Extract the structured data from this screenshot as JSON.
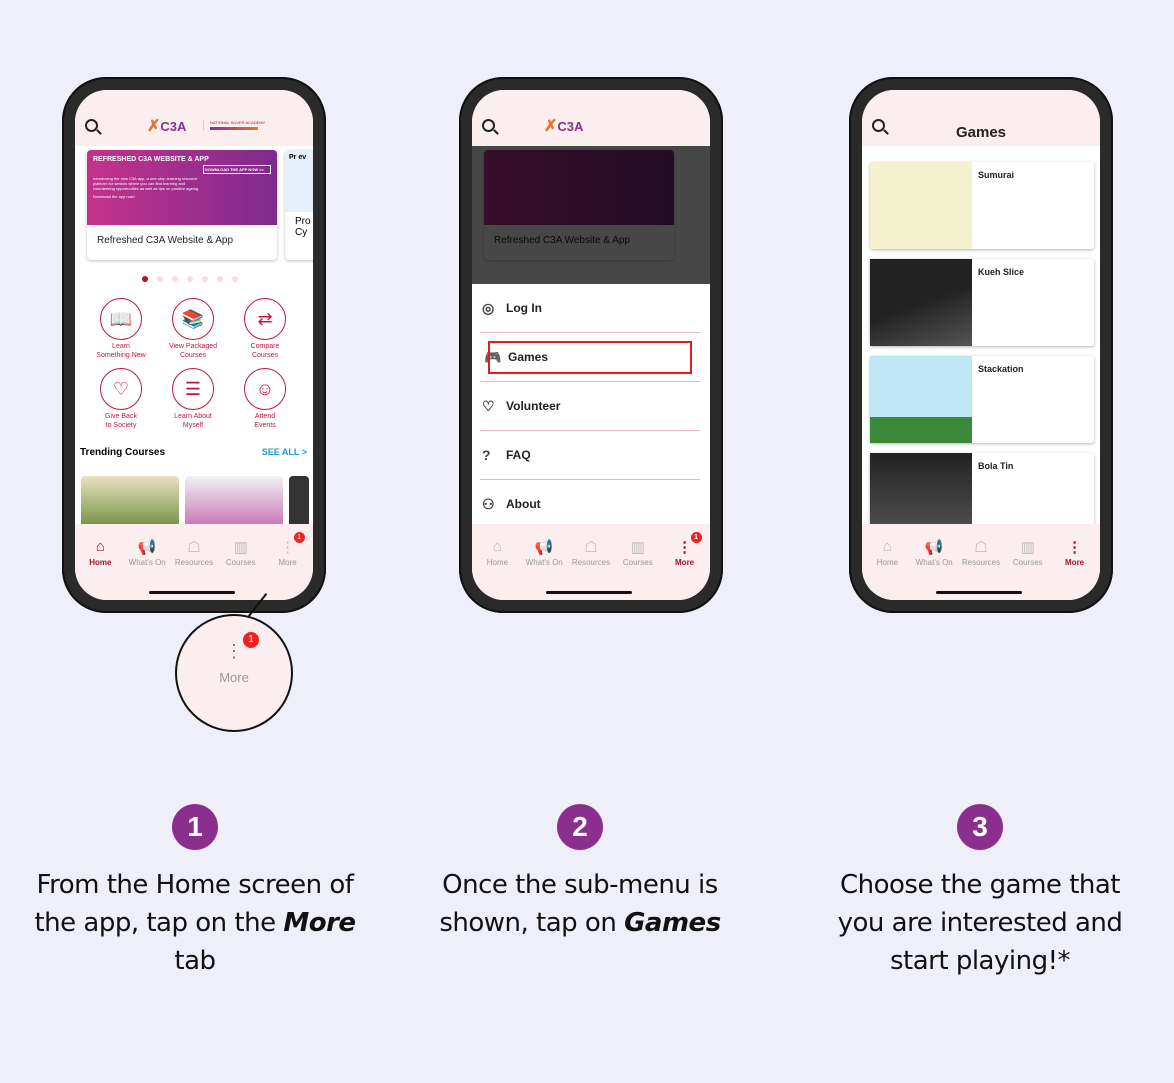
{
  "colors": {
    "accent": "#b0102c",
    "step": "#8b2f8f",
    "highlight": "#e01c1c",
    "link": "#1a9bd1"
  },
  "app": {
    "logo": "C3A",
    "partner_logo": "NATIONAL SILVER ACADEMY",
    "search_icon": "search-icon"
  },
  "home": {
    "banner": {
      "headline": "REFRESHED C3A WEBSITE & APP",
      "cta": "DOWNLOAD THE APP NOW >>",
      "body": "Introducing the new C3A app, a one-stop learning resource platform for seniors where you can find learning and volunteering opportunities as well as tips on positive ageing.",
      "download": "Download the app now!",
      "caption": "Refreshed C3A Website & App"
    },
    "banner2": {
      "title": "Pr ev",
      "caption": "Pro Cy"
    },
    "grid": [
      {
        "l1": "Learn",
        "l2": "Something New",
        "icon": "📖"
      },
      {
        "l1": "View Packaged",
        "l2": "Courses",
        "icon": "📚"
      },
      {
        "l1": "Compare",
        "l2": "Courses",
        "icon": "⇄"
      },
      {
        "l1": "Give Back",
        "l2": "to Society",
        "icon": "♡"
      },
      {
        "l1": "Learn About",
        "l2": "Myself",
        "icon": "☰"
      },
      {
        "l1": "Attend",
        "l2": "Events",
        "icon": "☺"
      }
    ],
    "trending": "Trending Courses",
    "see_all": "SEE ALL >"
  },
  "nav": [
    {
      "label": "Home",
      "icon": "⌂"
    },
    {
      "label": "What's On",
      "icon": "📢"
    },
    {
      "label": "Resources",
      "icon": "☖"
    },
    {
      "label": "Courses",
      "icon": "▥"
    },
    {
      "label": "More",
      "icon": "⋮"
    }
  ],
  "badge": "1",
  "menu": [
    {
      "label": "Log In",
      "icon": "◎"
    },
    {
      "label": "Games",
      "icon": "🎮"
    },
    {
      "label": "Volunteer",
      "icon": "♡"
    },
    {
      "label": "FAQ",
      "icon": "?"
    },
    {
      "label": "About",
      "icon": "⚇"
    }
  ],
  "games_screen": {
    "title": "Games",
    "games": [
      "Sumurai",
      "Kueh Slice",
      "Stackation",
      "Bola Tin"
    ]
  },
  "zoom_label": "More",
  "steps": [
    {
      "n": "1",
      "pre": "From the Home screen of the app, tap on the ",
      "bold": "More",
      "post": " tab"
    },
    {
      "n": "2",
      "pre": "Once the sub-menu is shown, tap on ",
      "bold": "Games",
      "post": ""
    },
    {
      "n": "3",
      "pre": "Choose the game that you are interested and start playing!*",
      "bold": "",
      "post": ""
    }
  ]
}
